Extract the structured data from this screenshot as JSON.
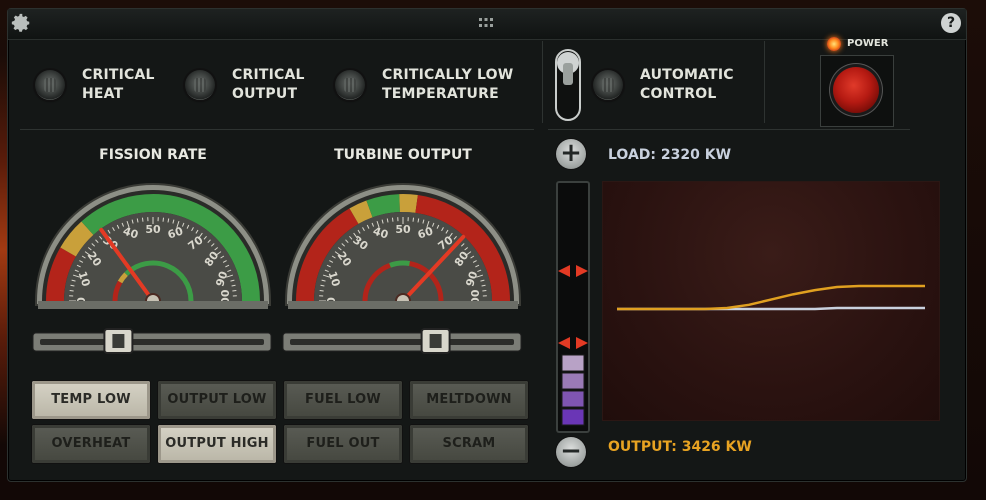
{
  "header": {
    "settings_icon": "gear-icon",
    "drag_icon": "drag-handle-icon",
    "help_label": "?"
  },
  "indicators": [
    {
      "line1": "CRITICAL",
      "line2": "HEAT",
      "icon": "warning-lamp-icon"
    },
    {
      "line1": "CRITICAL",
      "line2": "OUTPUT",
      "icon": "warning-lamp-icon"
    },
    {
      "line1": "CRITICALLY LOW",
      "line2": "TEMPERATURE",
      "icon": "warning-lamp-icon"
    },
    {
      "line1": "AUTOMATIC",
      "line2": "CONTROL",
      "icon": "warning-lamp-icon"
    }
  ],
  "power": {
    "label": "POWER",
    "button_color": "#c01f14"
  },
  "gauges": [
    {
      "title": "FISSION RATE",
      "ticks": [
        "0",
        "10",
        "20",
        "30",
        "40",
        "50",
        "60",
        "70",
        "80",
        "90",
        "100"
      ],
      "value": 30,
      "inner_value": 75
    },
    {
      "title": "TURBINE OUTPUT",
      "ticks": [
        "0",
        "10",
        "20",
        "30",
        "40",
        "50",
        "60",
        "70",
        "80",
        "90",
        "100"
      ],
      "value": 74,
      "inner_value": 45
    }
  ],
  "sliders": [
    {
      "name": "fission-rate-slider",
      "value": 35
    },
    {
      "name": "turbine-output-slider",
      "value": 65
    }
  ],
  "alarm_buttons": [
    {
      "label": "TEMP LOW",
      "lit": true
    },
    {
      "label": "OUTPUT LOW",
      "lit": false
    },
    {
      "label": "FUEL LOW",
      "lit": false
    },
    {
      "label": "MELTDOWN",
      "lit": false
    },
    {
      "label": "OVERHEAT",
      "lit": false
    },
    {
      "label": "OUTPUT HIGH",
      "lit": true
    },
    {
      "label": "FUEL OUT",
      "lit": false
    },
    {
      "label": "SCRAM",
      "lit": false
    }
  ],
  "load_panel": {
    "load_label": "LOAD: 2320 KW",
    "output_label": "OUTPUT: 3426 KW",
    "load_color": "#c9d1de",
    "output_color": "#e0a020",
    "bar_fill_levels": 4,
    "bar_total_levels": 4,
    "load_series": [
      0.53,
      0.53,
      0.53,
      0.53,
      0.53,
      0.53,
      0.53,
      0.53,
      0.53,
      0.53,
      0.535,
      0.535,
      0.535,
      0.535,
      0.535
    ],
    "output_series": [
      0.53,
      0.53,
      0.53,
      0.53,
      0.53,
      0.535,
      0.55,
      0.575,
      0.6,
      0.62,
      0.635,
      0.64,
      0.64,
      0.64,
      0.64
    ]
  },
  "colors": {
    "accent_gold": "#e0a020",
    "panel_bg": "#141716",
    "alarm_red": "#c01f14"
  }
}
